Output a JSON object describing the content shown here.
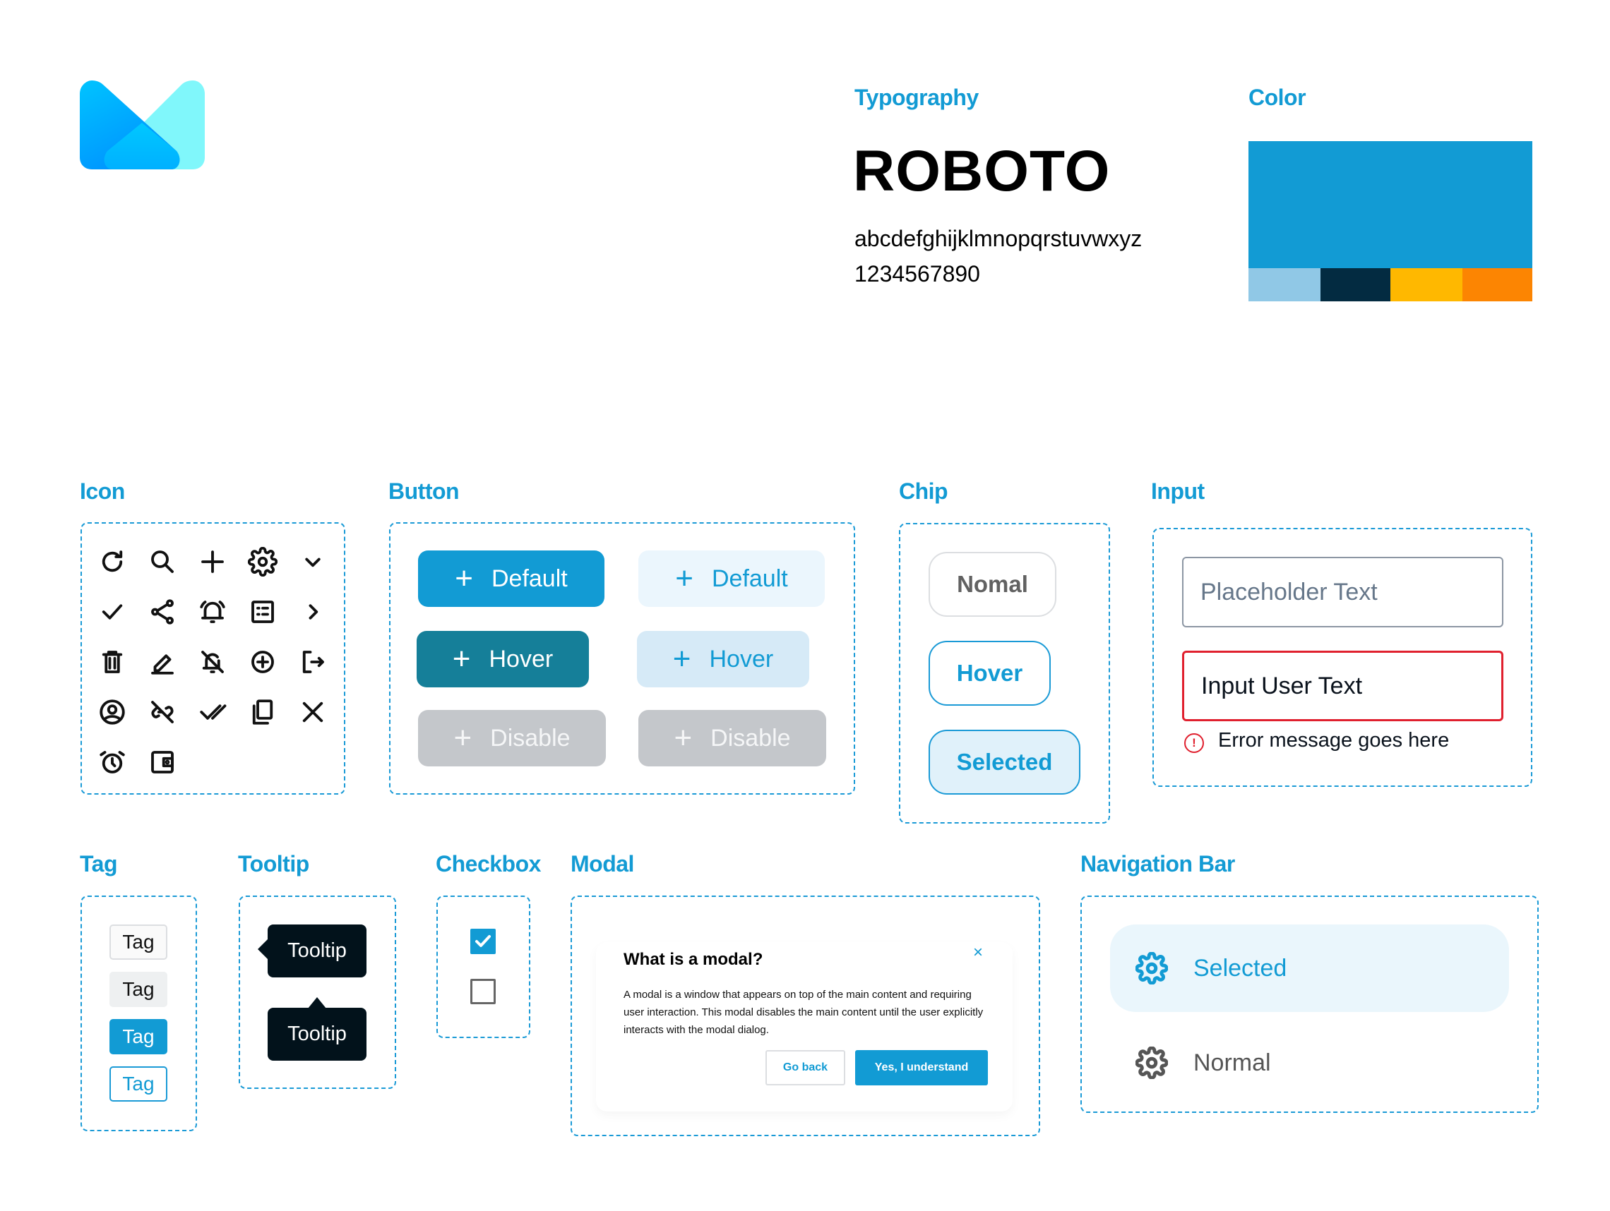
{
  "brand": {
    "logo_icon": "m-logo-icon",
    "colors": {
      "logo_dark": "#0096ff",
      "logo_mid": "#00c2ff",
      "logo_light": "#80f7fb"
    }
  },
  "typography": {
    "title": "Typography",
    "font_name": "ROBOTO",
    "alphabet": "abcdefghijklmnopqrstuvwxyz",
    "digits": "1234567890"
  },
  "color": {
    "title": "Color",
    "primary": "#129bd4",
    "palette": [
      "#90c8e6",
      "#032b41",
      "#ffb800",
      "#fc8502"
    ]
  },
  "icon_section": {
    "title": "Icon",
    "icons": [
      "refresh-icon",
      "search-icon",
      "plus-icon",
      "gear-icon",
      "chevron-down-icon",
      "check-icon",
      "share-icon",
      "bell-ringing-icon",
      "list-detail-icon",
      "chevron-right-icon",
      "trash-icon",
      "edit-icon",
      "bell-off-icon",
      "plus-circle-icon",
      "logout-icon",
      "account-circle-icon",
      "link-off-icon",
      "double-check-icon",
      "copy-icon",
      "close-icon",
      "alarm-icon",
      "wallet-icon"
    ]
  },
  "button_section": {
    "title": "Button",
    "buttons": [
      {
        "label": "Default",
        "icon": "plus-icon",
        "variant": "primary",
        "state": "default"
      },
      {
        "label": "Default",
        "icon": "plus-icon",
        "variant": "secondary",
        "state": "default"
      },
      {
        "label": "Hover",
        "icon": "plus-icon",
        "variant": "primary",
        "state": "hover"
      },
      {
        "label": "Hover",
        "icon": "plus-icon",
        "variant": "secondary",
        "state": "hover"
      },
      {
        "label": "Disable",
        "icon": "plus-icon",
        "variant": "primary",
        "state": "disabled"
      },
      {
        "label": "Disable",
        "icon": "plus-icon",
        "variant": "secondary",
        "state": "disabled"
      }
    ],
    "plus_glyph": "+"
  },
  "chip_section": {
    "title": "Chip",
    "chips": [
      "Nomal",
      "Hover",
      "Selected"
    ]
  },
  "input_section": {
    "title": "Input",
    "placeholder": "Placeholder Text",
    "error_value": "Input User Text",
    "error_message": "Error message goes here",
    "error_color": "#e0202e"
  },
  "tag_section": {
    "title": "Tag",
    "tags": [
      "Tag",
      "Tag",
      "Tag",
      "Tag"
    ]
  },
  "tooltip_section": {
    "title": "Tooltip",
    "tooltips": [
      "Tooltip",
      "Tooltip"
    ]
  },
  "checkbox_section": {
    "title": "Checkbox",
    "checkboxes": [
      {
        "checked": true
      },
      {
        "checked": false
      }
    ]
  },
  "modal_section": {
    "title": "Modal",
    "modal": {
      "heading": "What is a modal?",
      "body": "A modal is a window that appears on top of the main content and requiring user interaction. This modal disables the main content until the user explicitly interacts with the modal dialog.",
      "close_glyph": "×",
      "cancel_label": "Go back",
      "confirm_label": "Yes, I understand"
    }
  },
  "nav_section": {
    "title": "Navigation Bar",
    "items": [
      {
        "label": "Selected",
        "icon": "gear-icon",
        "selected": true
      },
      {
        "label": "Normal",
        "icon": "gear-icon",
        "selected": false
      }
    ]
  }
}
